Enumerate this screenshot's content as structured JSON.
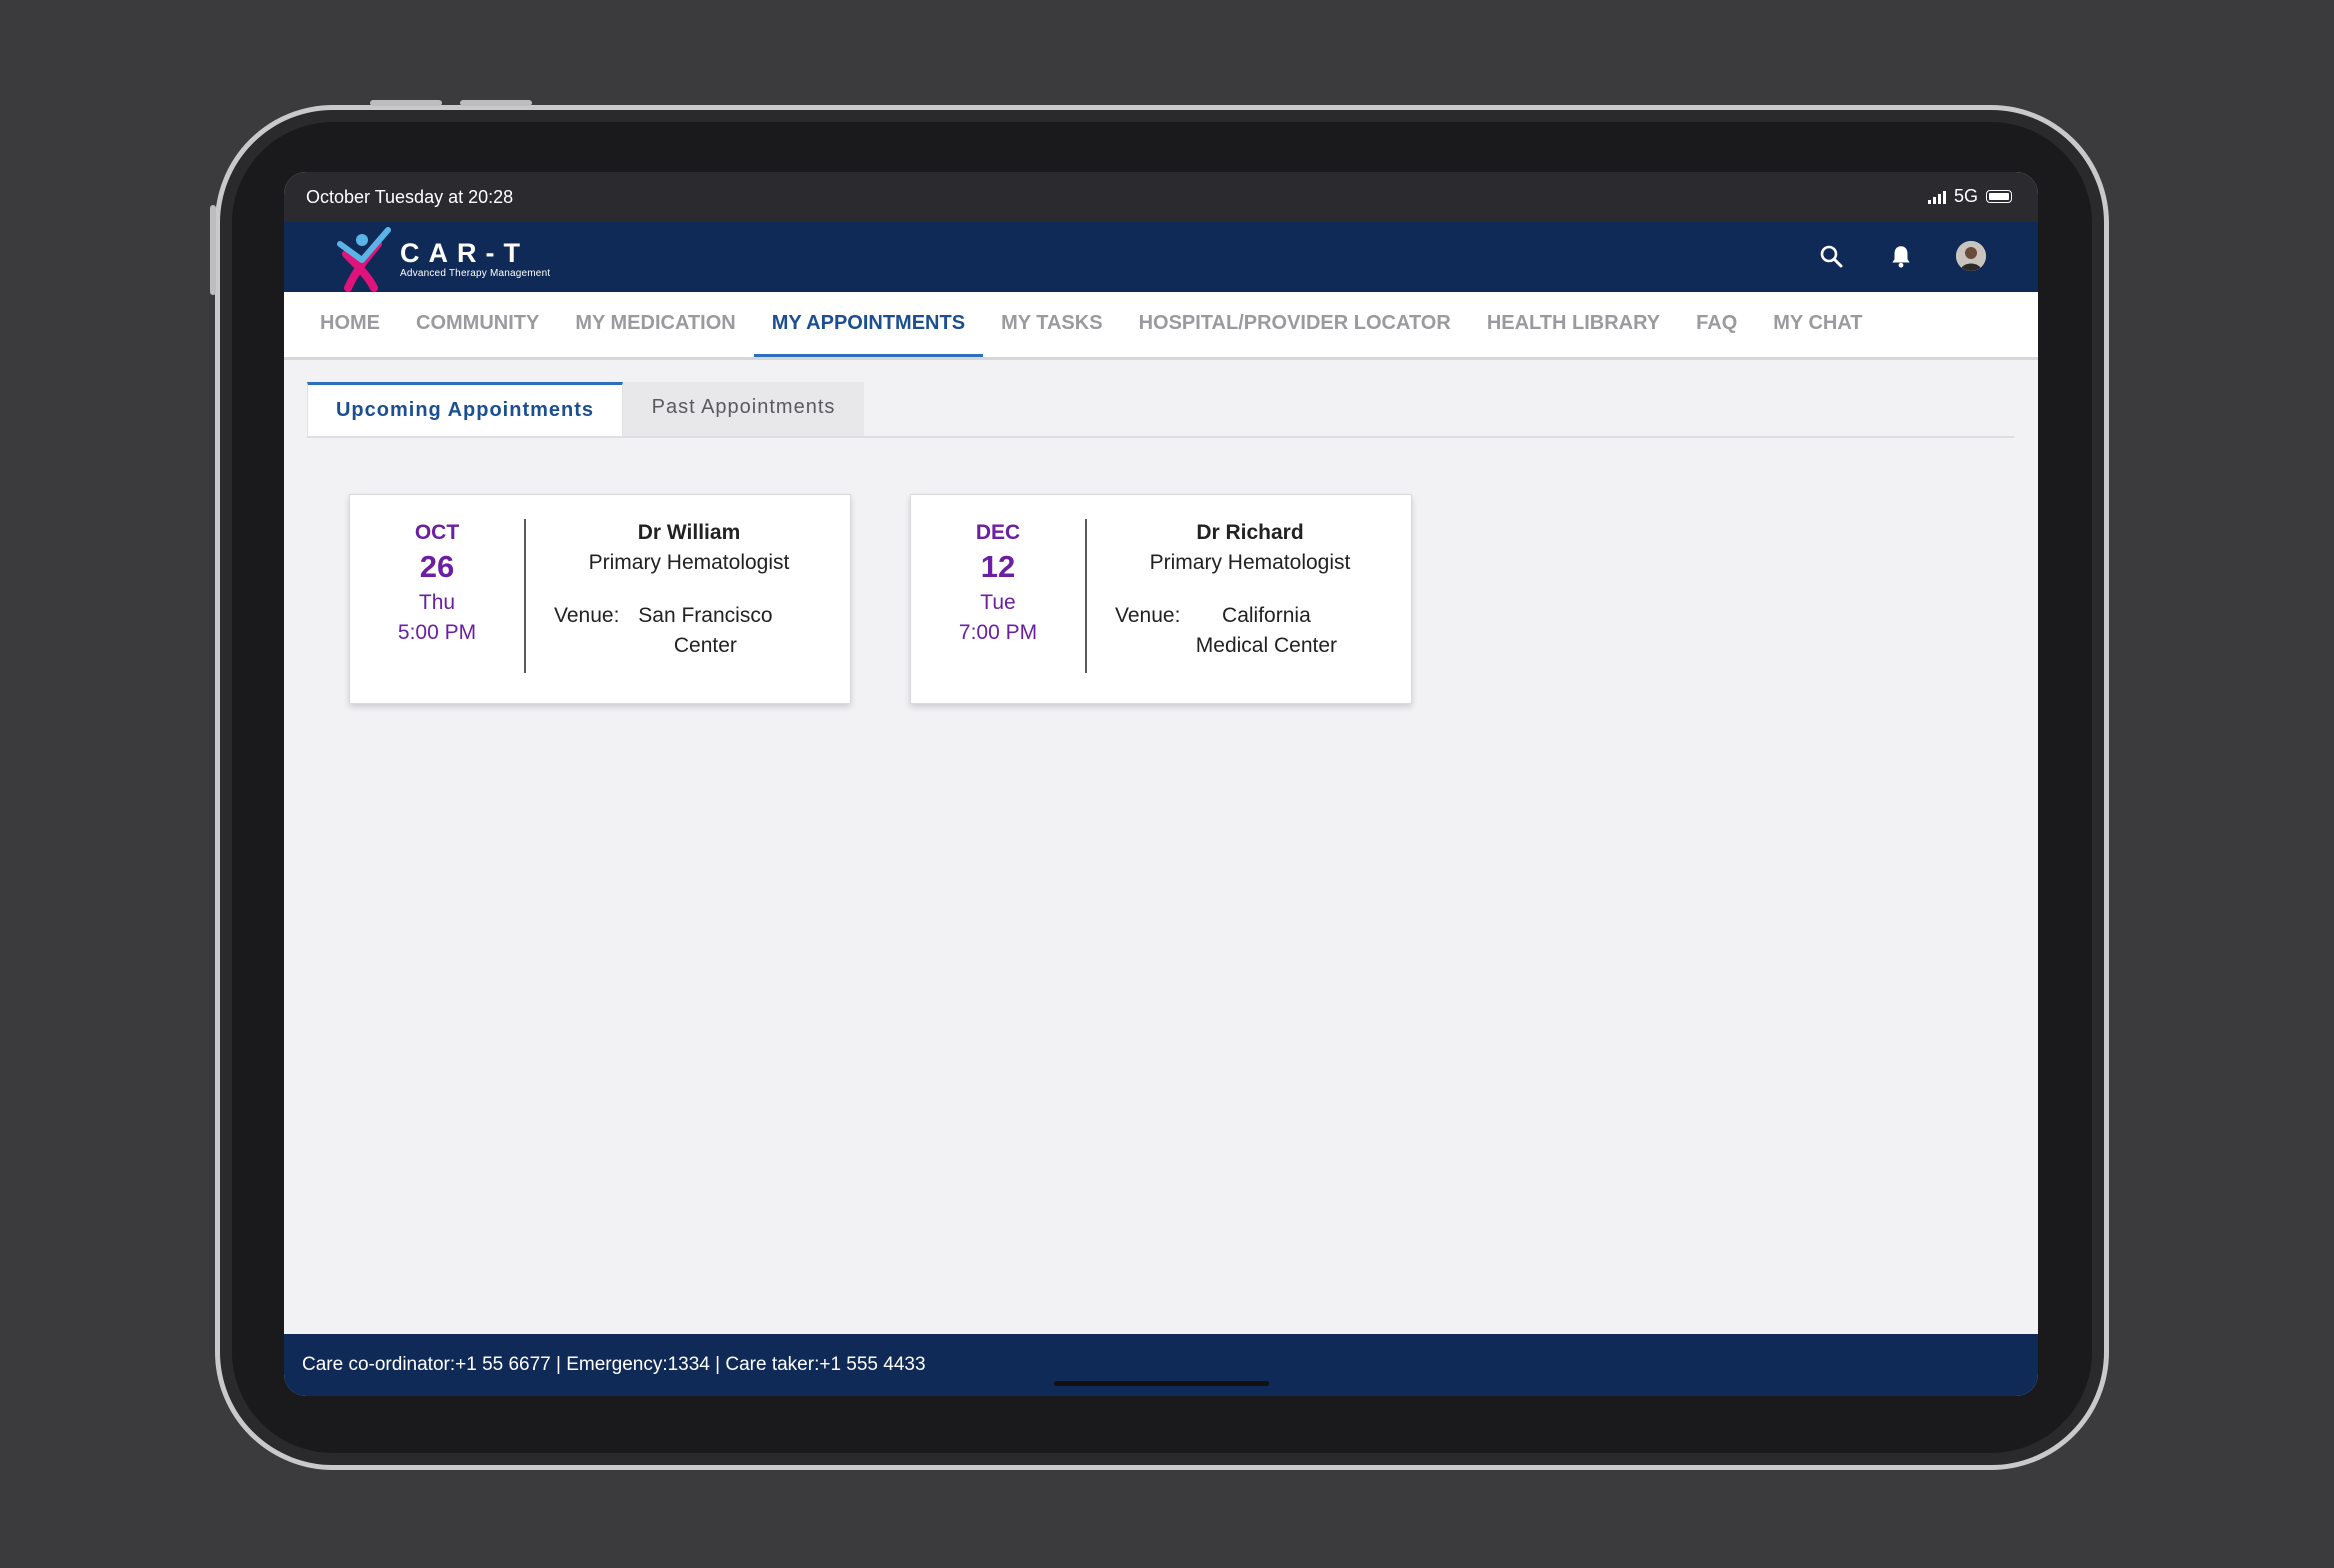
{
  "status_bar": {
    "time": "October Tuesday at 20:28",
    "network": "5G"
  },
  "app": {
    "logo_title": "CAR-T",
    "logo_subtitle": "Advanced Therapy Management",
    "brand_color": "#0f2a57",
    "accent_color": "#2d6fbf",
    "date_color": "#6b1fa3",
    "header_icons": [
      "search-icon",
      "bell-icon",
      "avatar"
    ]
  },
  "nav": {
    "items": [
      {
        "label": "HOME"
      },
      {
        "label": "COMMUNITY"
      },
      {
        "label": "MY MEDICATION"
      },
      {
        "label": "MY APPOINTMENTS",
        "active": true
      },
      {
        "label": "MY TASKS"
      },
      {
        "label": "HOSPITAL/PROVIDER LOCATOR"
      },
      {
        "label": "HEALTH LIBRARY"
      },
      {
        "label": "FAQ"
      },
      {
        "label": "MY CHAT"
      }
    ]
  },
  "tabs": {
    "upcoming": "Upcoming Appointments",
    "past": "Past Appointments",
    "active": "upcoming"
  },
  "appointments": [
    {
      "month": "OCT",
      "day": "26",
      "weekday": "Thu",
      "time": "5:00 PM",
      "doctor": "Dr William",
      "role": "Primary Hematologist",
      "venue_label": "Venue:",
      "venue": "San Francisco Center"
    },
    {
      "month": "DEC",
      "day": "12",
      "weekday": "Tue",
      "time": "7:00 PM",
      "doctor": "Dr Richard",
      "role": "Primary Hematologist",
      "venue_label": "Venue:",
      "venue": "California Medical Center"
    }
  ],
  "footer": {
    "text": "Care co-ordinator:+1 55 6677 | Emergency:1334 | Care taker:+1 555 4433"
  }
}
